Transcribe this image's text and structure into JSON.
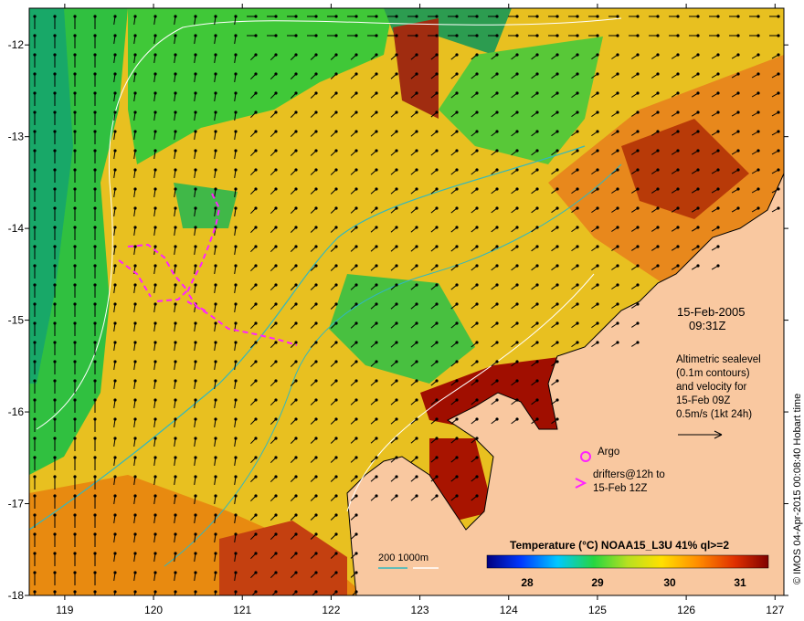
{
  "map": {
    "x_ticks": [
      "119",
      "120",
      "121",
      "122",
      "123",
      "124",
      "125",
      "126",
      "127"
    ],
    "y_ticks": [
      "-12",
      "-13",
      "-14",
      "-15",
      "-16",
      "-17",
      "-18"
    ],
    "lon_range": [
      118.6,
      127.1
    ],
    "lat_range": [
      -11.6,
      -18.0
    ]
  },
  "annotations": {
    "date": "15-Feb-2005",
    "time": "09:31Z",
    "alt_line1": "Altimetric sealevel",
    "alt_line2": "(0.1m contours)",
    "alt_line3": "and velocity for",
    "alt_line4": "15-Feb 09Z",
    "alt_line5": "0.5m/s (1kt 24h)",
    "argo_label": "Argo",
    "drifters_line1": "drifters@12h to",
    "drifters_line2": "15-Feb 12Z",
    "bathy_label": "200  1000m",
    "side_text": "© IMOS 04-Apr-2015 00:08:40 Hobart time"
  },
  "colorbar": {
    "title": "Temperature (°C) NOAA15_L3U 41% ql>=2",
    "ticks": [
      "28",
      "29",
      "30",
      "31"
    ]
  },
  "colors": {
    "land": "#f9c8a0",
    "drifter": "#ff22ff",
    "bathy_200": "#30b8c0",
    "bathy_1000": "#ffffff"
  }
}
